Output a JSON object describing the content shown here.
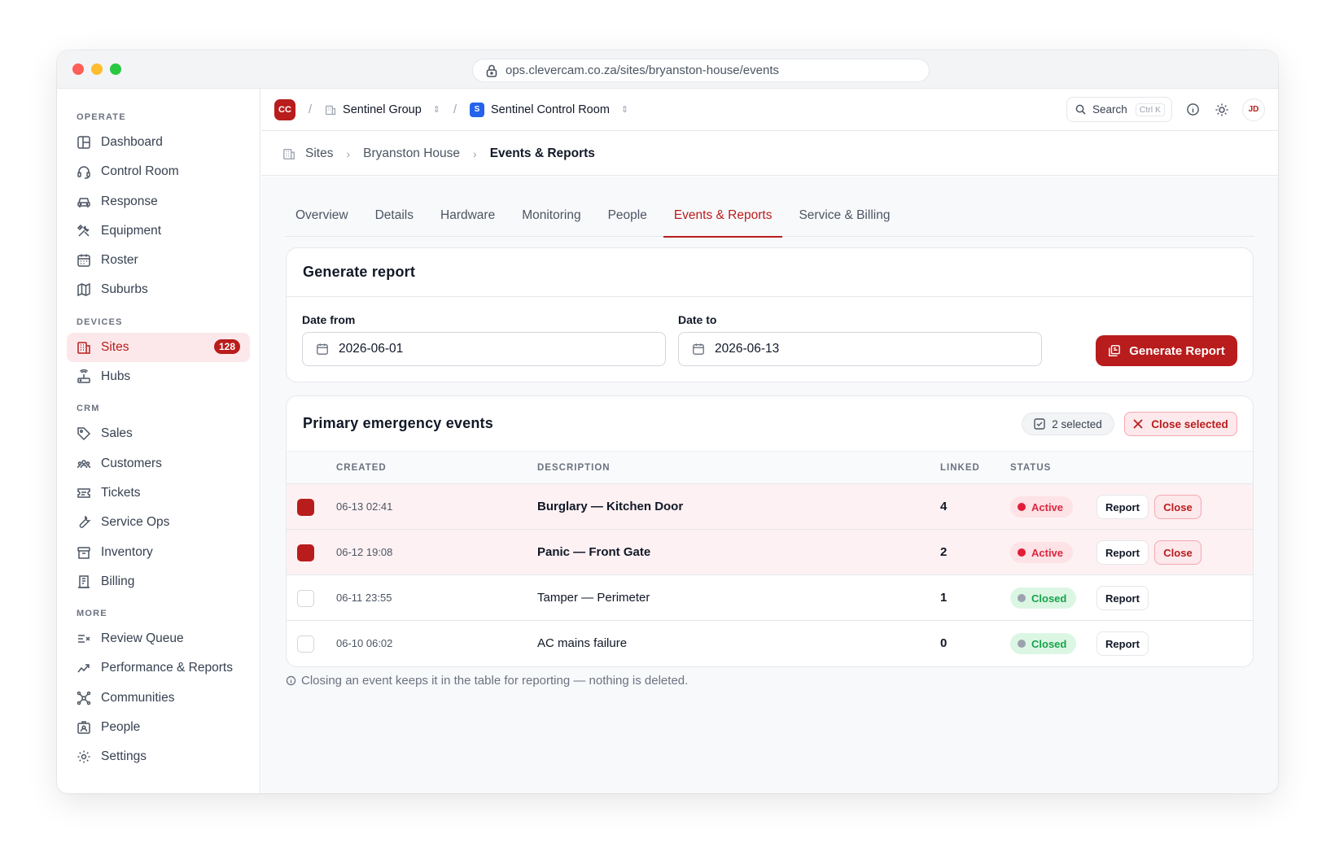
{
  "browser": {
    "url": "ops.clevercam.co.za/sites/bryanston-house/events"
  },
  "sidebar": {
    "sections": [
      {
        "label": "OPERATE",
        "items": [
          {
            "label": "Dashboard",
            "icon": "layout-icon"
          },
          {
            "label": "Control Room",
            "icon": "headset-icon"
          },
          {
            "label": "Response",
            "icon": "car-icon"
          },
          {
            "label": "Equipment",
            "icon": "tools-icon"
          },
          {
            "label": "Roster",
            "icon": "calendar-icon"
          },
          {
            "label": "Suburbs",
            "icon": "map-icon"
          }
        ]
      },
      {
        "label": "DEVICES",
        "items": [
          {
            "label": "Sites",
            "icon": "building-icon",
            "badge": "128"
          },
          {
            "label": "Hubs",
            "icon": "router-icon"
          }
        ]
      },
      {
        "label": "CRM",
        "items": [
          {
            "label": "Sales",
            "icon": "tag-icon"
          },
          {
            "label": "Customers",
            "icon": "users-icon"
          },
          {
            "label": "Tickets",
            "icon": "ticket-icon"
          },
          {
            "label": "Service Ops",
            "icon": "wrench-icon"
          },
          {
            "label": "Inventory",
            "icon": "archive-icon"
          },
          {
            "label": "Billing",
            "icon": "receipt-icon"
          }
        ]
      },
      {
        "label": "MORE",
        "items": [
          {
            "label": "Review Queue",
            "icon": "list-x-icon"
          },
          {
            "label": "Performance & Reports",
            "icon": "trend-icon"
          },
          {
            "label": "Communities",
            "icon": "network-icon"
          },
          {
            "label": "People",
            "icon": "id-badge-icon"
          },
          {
            "label": "Settings",
            "icon": "gear-icon"
          }
        ]
      }
    ]
  },
  "topbar": {
    "org_initials": "CC",
    "org_name": "Sentinel Group",
    "workspace_initial": "S",
    "workspace_name": "Sentinel Control Room",
    "search_label": "Search",
    "search_shortcut": "Ctrl K",
    "avatar_initials": "JD"
  },
  "breadcrumb": {
    "root": "Sites",
    "parent": "Bryanston House",
    "current": "Events & Reports"
  },
  "tabs": [
    "Overview",
    "Details",
    "Hardware",
    "Monitoring",
    "People",
    "Events & Reports",
    "Service & Billing"
  ],
  "report": {
    "title": "Generate report",
    "date_from_label": "Date from",
    "date_from": "2026-06-01",
    "date_to_label": "Date to",
    "date_to": "2026-06-13",
    "button": "Generate Report"
  },
  "events": {
    "title": "Primary emergency events",
    "selected_count": "2 selected",
    "close_selected": "Close selected",
    "columns": {
      "created": "CREATED",
      "description": "DESCRIPTION",
      "linked": "LINKED",
      "status": "STATUS"
    },
    "report_label": "Report",
    "close_label": "Close",
    "rows": [
      {
        "created": "06-13 02:41",
        "description": "Burglary — Kitchen Door",
        "linked": "4",
        "status": "Active",
        "selected": true
      },
      {
        "created": "06-12 19:08",
        "description": "Panic — Front Gate",
        "linked": "2",
        "status": "Active",
        "selected": true
      },
      {
        "created": "06-11 23:55",
        "description": "Tamper — Perimeter",
        "linked": "1",
        "status": "Closed",
        "selected": false
      },
      {
        "created": "06-10 06:02",
        "description": "AC mains failure",
        "linked": "0",
        "status": "Closed",
        "selected": false
      }
    ]
  },
  "footnote": "Closing an event keeps it in the table for reporting — nothing is deleted.",
  "colors": {
    "accent": "#b91c1c",
    "active_status": "#dc2640",
    "closed_status": "#16a34a"
  }
}
